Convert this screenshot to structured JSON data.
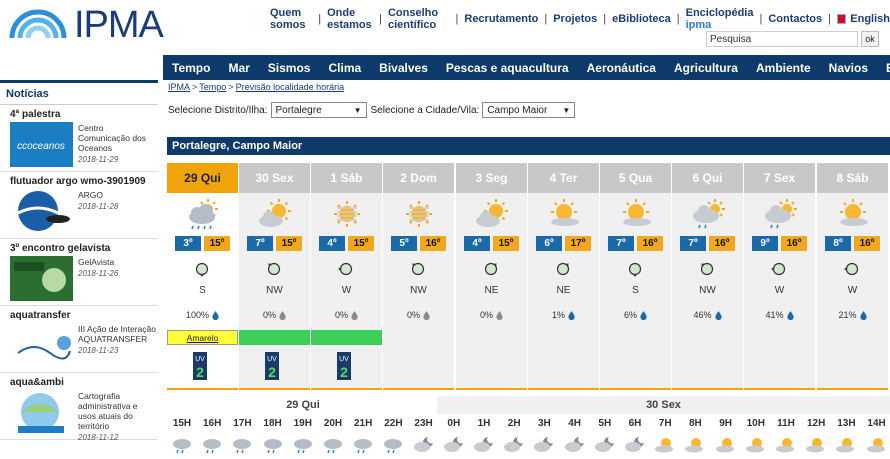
{
  "header": {
    "logo_text": "IPMA",
    "links": [
      "Quem somos",
      "Onde estamos",
      "Conselho científico",
      "Recrutamento",
      "Projetos",
      "eBiblioteca"
    ],
    "encyclopedia_prefix": "Enciclopédia",
    "encyclopedia_brand": "ipma",
    "contacts": "Contactos",
    "english": "English",
    "search_placeholder": "Pesquisa",
    "ok_label": "ok"
  },
  "nav": [
    "Tempo",
    "Mar",
    "Sismos",
    "Clima",
    "Bivalves",
    "Pescas e aquacultura",
    "Aeronáutica",
    "Agricultura",
    "Ambiente",
    "Navios",
    "Espaço"
  ],
  "sidebar": {
    "heading": "Notícias",
    "news": [
      {
        "title": "4ª palestra",
        "desc": "Centro Comunicação dos Oceanos",
        "date": "2018-11-29"
      },
      {
        "title": "flutuador argo wmo-3901909",
        "desc": "ARGO",
        "date": "2018-11-28"
      },
      {
        "title": "3º encontro gelavista",
        "desc": "GelAvista",
        "date": "2018-11-26"
      },
      {
        "title": "aquatransfer",
        "desc": "III Ação de Interação AQUATRANSFER",
        "date": "2018-11-23"
      },
      {
        "title": "aqua&ambi",
        "desc": "Cartografia administrativa e usos atuais do território",
        "date": "2018-11-12"
      }
    ]
  },
  "breadcrumb": [
    "IPMA",
    "Tempo",
    "Previsão localidade horária"
  ],
  "selectors": {
    "district_label": "Selecione Distrito/Ilha:",
    "district_value": "Portalegre",
    "city_label": "Selecione a Cidade/Vila:",
    "city_value": "Campo Maior"
  },
  "location_title": "Portalegre, Campo Maior",
  "days": [
    {
      "label": "29 Qui",
      "min": "3º",
      "max": "15º",
      "wind": "S",
      "precip": "100%",
      "icon": "rain-cloud-icon",
      "warning": "Amarelo",
      "warn_color": "#ffff33",
      "uv": "2"
    },
    {
      "label": "30 Sex",
      "min": "7º",
      "max": "15º",
      "wind": "NW",
      "precip": "0%",
      "icon": "partly-cloudy-icon",
      "warning": "",
      "warn_color": "#3ecf5a",
      "uv": "2"
    },
    {
      "label": "1 Sáb",
      "min": "4º",
      "max": "15º",
      "wind": "W",
      "precip": "0%",
      "icon": "hazy-sun-icon",
      "warning": "",
      "warn_color": "#3ecf5a",
      "uv": "2"
    },
    {
      "label": "2 Dom",
      "min": "5º",
      "max": "16º",
      "wind": "NW",
      "precip": "0%",
      "icon": "hazy-sun-icon",
      "warning": "",
      "warn_color": "",
      "uv": ""
    },
    {
      "label": "3 Seg",
      "min": "4º",
      "max": "15º",
      "wind": "NE",
      "precip": "0%",
      "icon": "partly-cloudy-icon",
      "warning": "",
      "warn_color": "",
      "uv": ""
    },
    {
      "label": "4 Ter",
      "min": "6º",
      "max": "17º",
      "wind": "NE",
      "precip": "1%",
      "icon": "sun-cloud-icon",
      "warning": "",
      "warn_color": "",
      "uv": ""
    },
    {
      "label": "5 Qua",
      "min": "7º",
      "max": "16º",
      "wind": "S",
      "precip": "6%",
      "icon": "sun-cloud-icon",
      "warning": "",
      "warn_color": "",
      "uv": ""
    },
    {
      "label": "6 Qui",
      "min": "7º",
      "max": "16º",
      "wind": "NW",
      "precip": "46%",
      "icon": "showers-icon",
      "warning": "",
      "warn_color": "",
      "uv": ""
    },
    {
      "label": "7 Sex",
      "min": "9º",
      "max": "16º",
      "wind": "W",
      "precip": "41%",
      "icon": "showers-icon",
      "warning": "",
      "warn_color": "",
      "uv": ""
    },
    {
      "label": "8 Sáb",
      "min": "8º",
      "max": "16º",
      "wind": "W",
      "precip": "21%",
      "icon": "sun-cloud-icon",
      "warning": "",
      "warn_color": "",
      "uv": ""
    }
  ],
  "hourly": {
    "day1_label": "29 Qui",
    "day2_label": "30 Sex",
    "hours": [
      "15H",
      "16H",
      "17H",
      "18H",
      "19H",
      "20H",
      "21H",
      "22H",
      "23H",
      "0H",
      "1H",
      "2H",
      "3H",
      "4H",
      "5H",
      "6H",
      "7H",
      "8H",
      "9H",
      "10H",
      "11H",
      "12H",
      "13H",
      "14H"
    ]
  },
  "colors": {
    "navy": "#0d3a6b",
    "orange": "#f0a30a",
    "blue_min": "#1a6aa8",
    "orange_max": "#f4a71d"
  }
}
